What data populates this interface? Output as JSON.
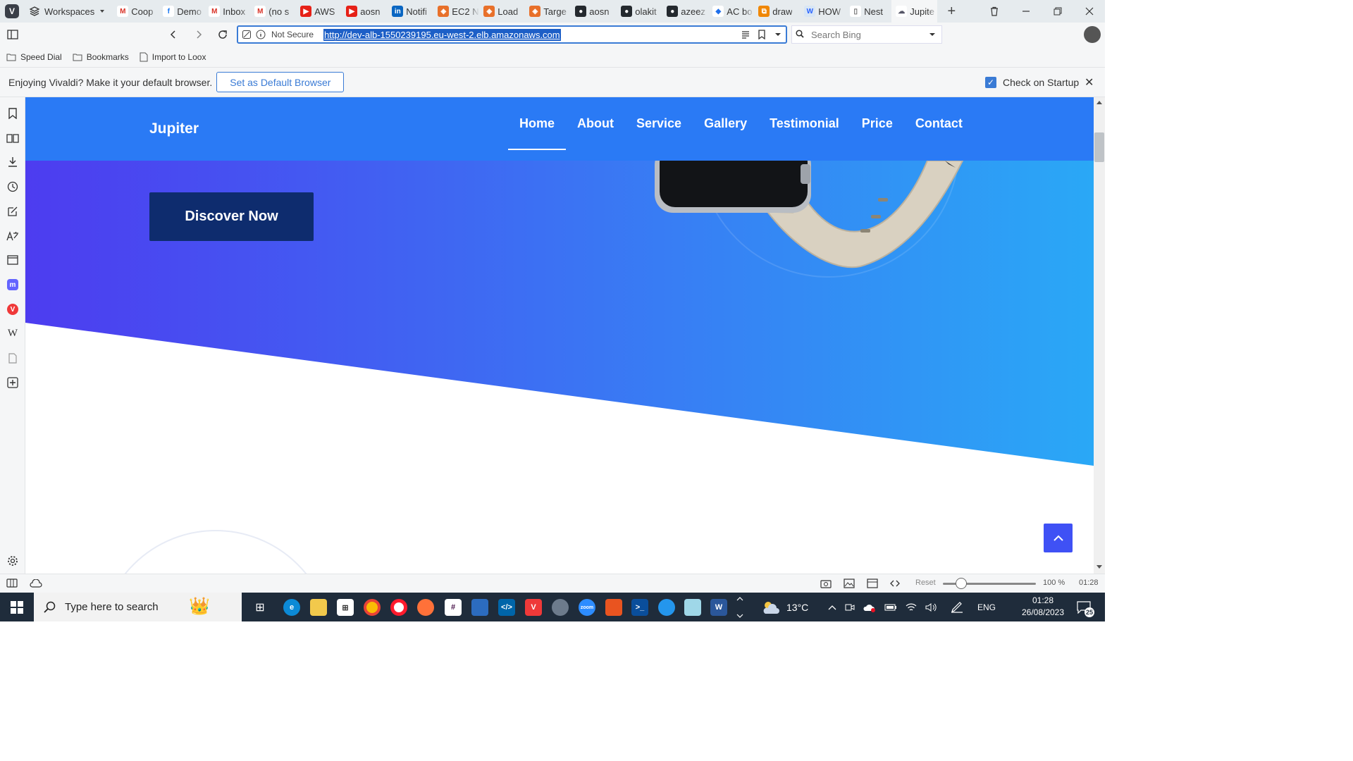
{
  "browser": {
    "workspaces_label": "Workspaces",
    "tabs": [
      {
        "label": "Coop",
        "icon": "gmail-icon",
        "color": "#ffffff",
        "glyph": "M",
        "fg": "#d93025"
      },
      {
        "label": "Demo",
        "icon": "facebook-icon",
        "color": "#ffffff",
        "glyph": "f",
        "fg": "#1877f2"
      },
      {
        "label": "Inbox",
        "icon": "gmail-icon",
        "color": "#ffffff",
        "glyph": "M",
        "fg": "#d93025"
      },
      {
        "label": "(no s",
        "icon": "gmail-icon",
        "color": "#ffffff",
        "glyph": "M",
        "fg": "#d93025"
      },
      {
        "label": "AWS",
        "icon": "youtube-icon",
        "color": "#e62117",
        "glyph": "▶",
        "fg": "#ffffff"
      },
      {
        "label": "aosn",
        "icon": "youtube-icon",
        "color": "#e62117",
        "glyph": "▶",
        "fg": "#ffffff"
      },
      {
        "label": "Notifi",
        "icon": "linkedin-icon",
        "color": "#0a66c2",
        "glyph": "in",
        "fg": "#ffffff"
      },
      {
        "label": "EC2 N",
        "icon": "aws-icon",
        "color": "#e8702a",
        "glyph": "◈",
        "fg": "#ffffff"
      },
      {
        "label": "Load",
        "icon": "aws-icon",
        "color": "#e8702a",
        "glyph": "◈",
        "fg": "#ffffff"
      },
      {
        "label": "Targe",
        "icon": "aws-icon",
        "color": "#e8702a",
        "glyph": "◈",
        "fg": "#ffffff"
      },
      {
        "label": "aosn",
        "icon": "github-icon",
        "color": "#24292e",
        "glyph": "●",
        "fg": "#ffffff"
      },
      {
        "label": "olakit",
        "icon": "github-icon",
        "color": "#24292e",
        "glyph": "●",
        "fg": "#ffffff"
      },
      {
        "label": "azeez",
        "icon": "github-icon",
        "color": "#24292e",
        "glyph": "●",
        "fg": "#ffffff"
      },
      {
        "label": "AC bo",
        "icon": "diamond-icon",
        "color": "#ffffff",
        "glyph": "◆",
        "fg": "#1f6feb"
      },
      {
        "label": "draw",
        "icon": "drawio-icon",
        "color": "#f08705",
        "glyph": "⧉",
        "fg": "#ffffff"
      },
      {
        "label": "HOW",
        "icon": "hashnode-icon",
        "color": "#d8e6f5",
        "glyph": "W",
        "fg": "#2962ff"
      },
      {
        "label": "Nest",
        "icon": "page-icon",
        "color": "#ffffff",
        "glyph": "▯",
        "fg": "#666666"
      },
      {
        "label": "Jupite",
        "icon": "site-icon",
        "color": "#ffffff",
        "glyph": "☁",
        "fg": "#556"
      }
    ],
    "not_secure": "Not Secure",
    "url": "http://dev-alb-1550239195.eu-west-2.elb.amazonaws.com",
    "search_placeholder": "Search Bing",
    "bookmarks": [
      "Speed Dial",
      "Bookmarks",
      "Import to Loox"
    ],
    "notification": {
      "message": "Enjoying Vivaldi? Make it your default browser.",
      "button": "Set as Default Browser",
      "checkbox_label": "Check on Startup"
    },
    "status": {
      "reset": "Reset",
      "zoom": "100 %",
      "time": "01:28"
    }
  },
  "site": {
    "brand": "Jupiter",
    "menu": [
      "Home",
      "About",
      "Service",
      "Gallery",
      "Testimonial",
      "Price",
      "Contact"
    ],
    "active_menu": "Home",
    "cta": "Discover Now",
    "colors": {
      "nav": "#2a7af5",
      "hero_start": "#4d3cf0",
      "hero_end": "#2aa8f6",
      "cta": "#0e2c6e",
      "totop": "#3f51f5"
    }
  },
  "taskbar": {
    "search_placeholder": "Type here to search",
    "temperature": "13°C",
    "language": "ENG",
    "time": "01:28",
    "date": "26/08/2023",
    "notifications": "25"
  }
}
